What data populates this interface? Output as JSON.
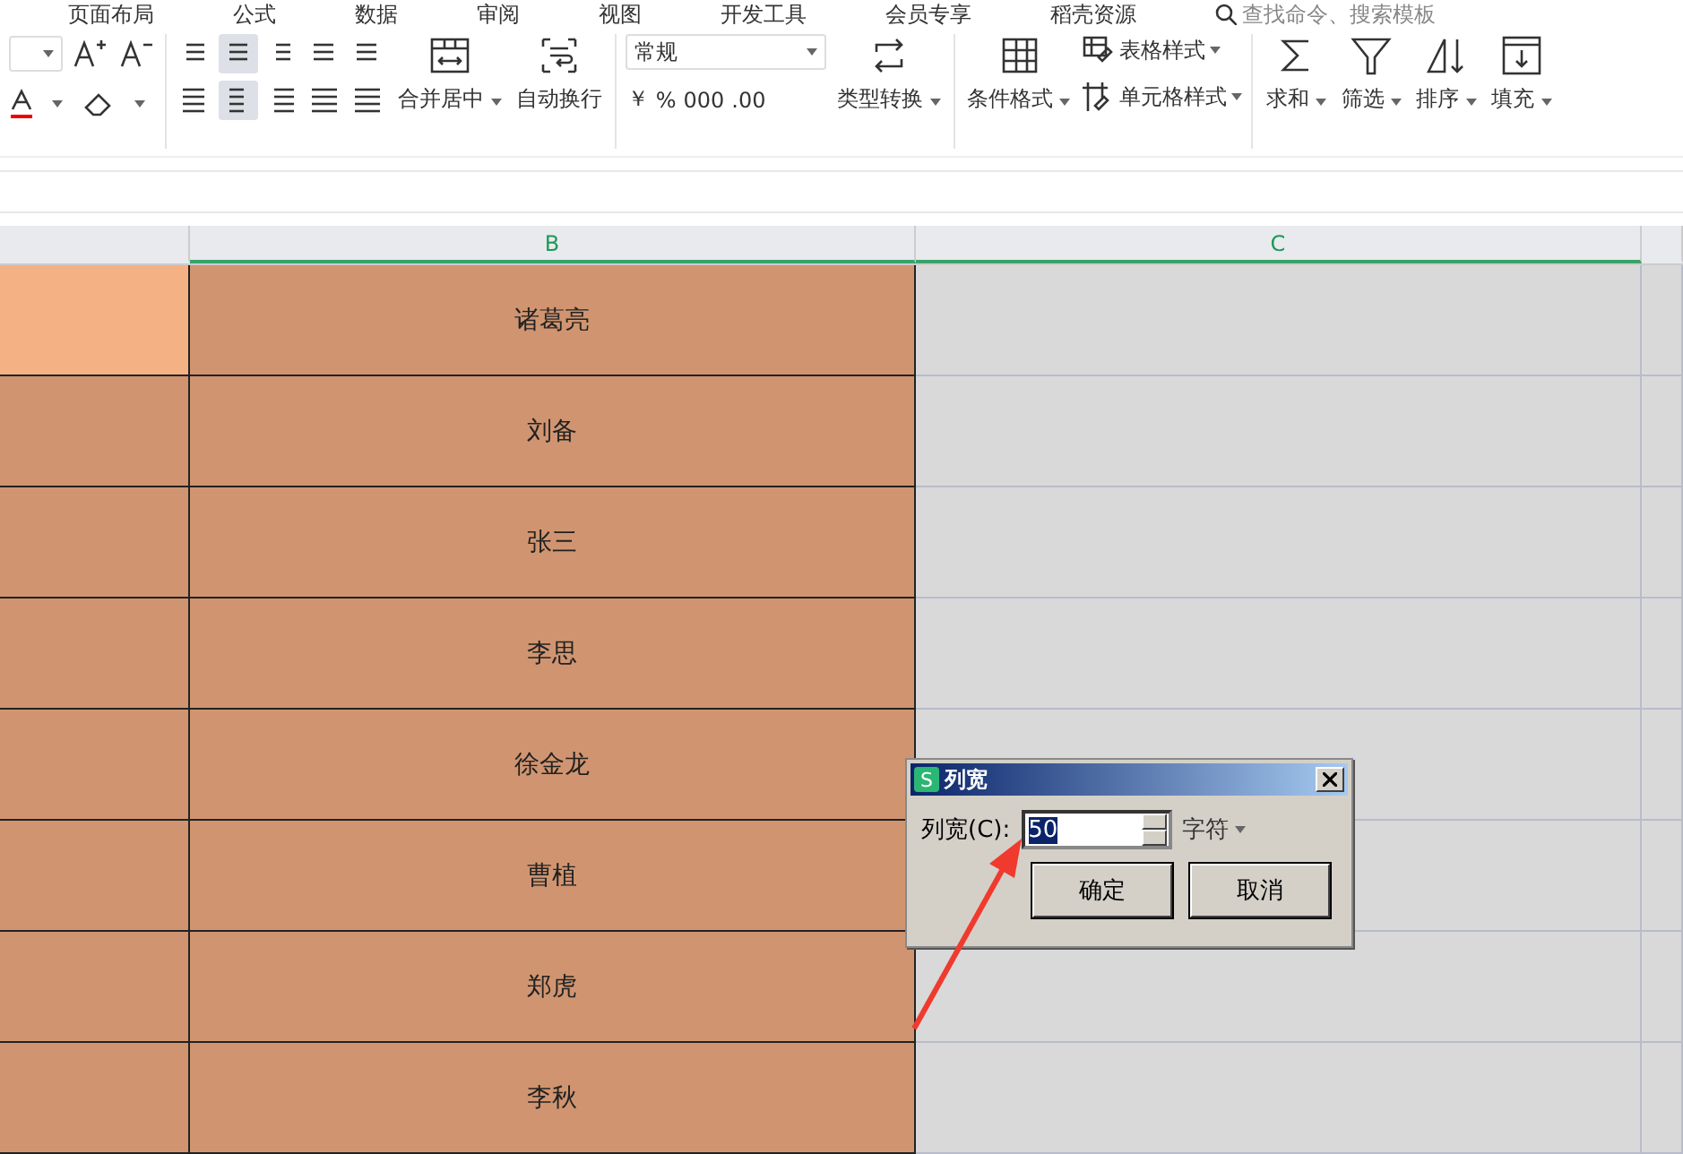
{
  "menu": [
    "页面布局",
    "公式",
    "数据",
    "审阅",
    "视图",
    "开发工具",
    "会员专享",
    "稻壳资源"
  ],
  "search": {
    "placeholder": "查找命令、搜索模板"
  },
  "ribbon": {
    "align_active": [
      false,
      true,
      false,
      false,
      false,
      false,
      true,
      false,
      false,
      false
    ],
    "merge_label": "合并居中",
    "wrap_label": "自动换行",
    "number_format": "常规",
    "number_symbols": [
      "￥",
      "%",
      "000",
      ".00"
    ],
    "convert_label": "类型转换",
    "cond_label": "条件格式",
    "table_style_label": "表格样式",
    "cell_style_label": "单元格样式",
    "tools": [
      {
        "kind": "sum",
        "label": "求和"
      },
      {
        "kind": "filter",
        "label": "筛选"
      },
      {
        "kind": "sort",
        "label": "排序"
      },
      {
        "kind": "fill",
        "label": "填充"
      }
    ]
  },
  "columns": [
    {
      "selected": false
    },
    {
      "label": "B",
      "selected": true
    },
    {
      "label": "C",
      "selected": true
    }
  ],
  "rows": [
    {
      "name": "诸葛亮",
      "a_active": true
    },
    {
      "name": "刘备",
      "a_active": false
    },
    {
      "name": "张三",
      "a_active": false
    },
    {
      "name": "李思",
      "a_active": false
    },
    {
      "name": "徐金龙",
      "a_active": false
    },
    {
      "name": "曹植",
      "a_active": false
    },
    {
      "name": "郑虎",
      "a_active": false
    },
    {
      "name": "李秋",
      "a_active": false
    }
  ],
  "dialog": {
    "logo": "S",
    "title": "列宽",
    "label": "列宽(C):",
    "value": "50",
    "unit": "字符",
    "buttons": [
      "确定",
      "取消"
    ]
  }
}
